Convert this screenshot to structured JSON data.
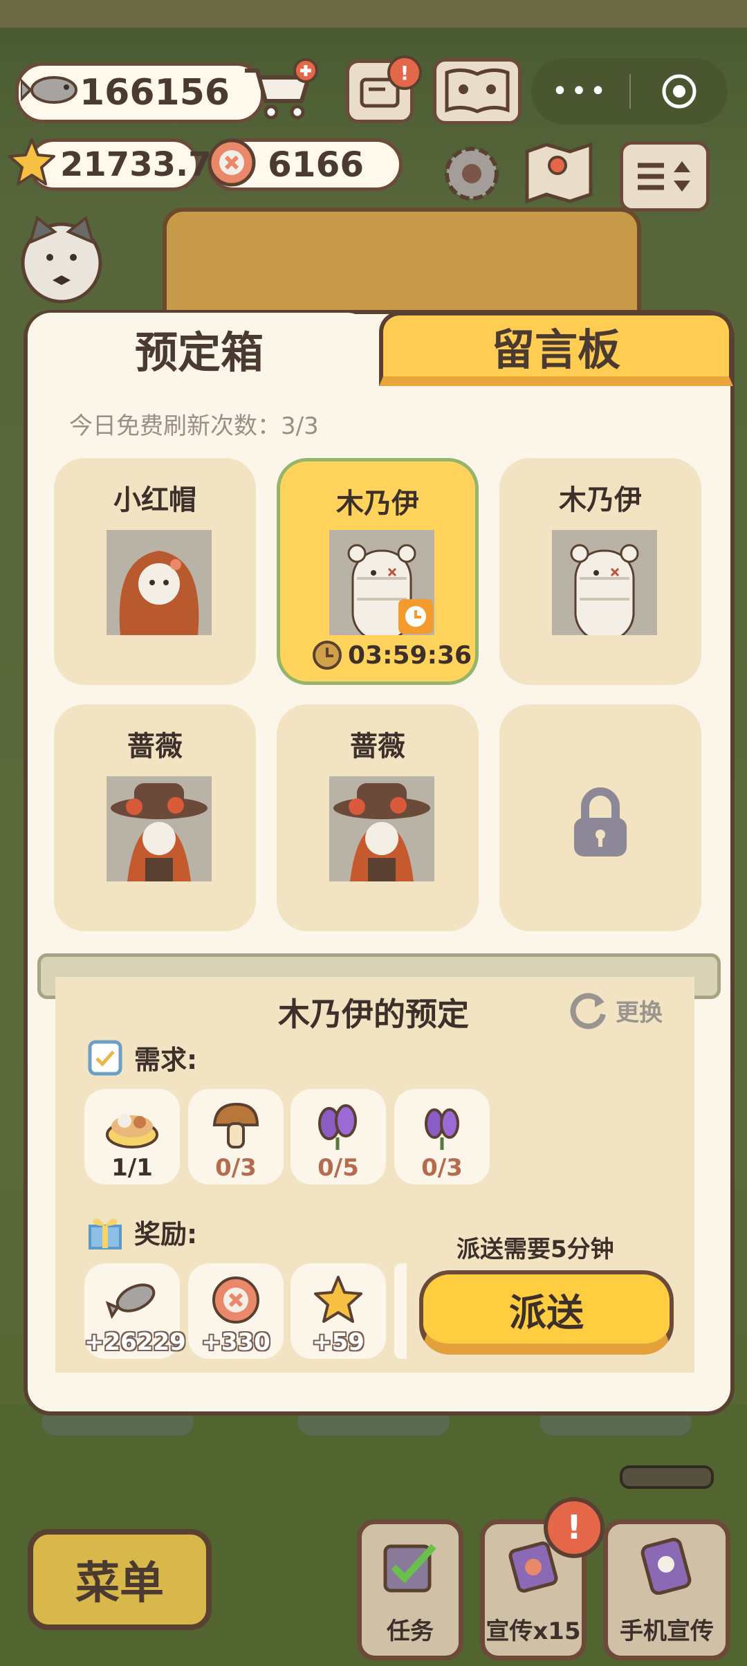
{
  "hud": {
    "fish": "166156",
    "stars": "21733.7",
    "coins": "6166"
  },
  "tabs": [
    {
      "label": "预定箱",
      "active": true
    },
    {
      "label": "留言板",
      "active": false
    }
  ],
  "refresh_text": "今日免费刷新次数：3/3",
  "cards": [
    {
      "name": "小红帽"
    },
    {
      "name": "木乃伊",
      "timer": "03:59:36"
    },
    {
      "name": "木乃伊"
    },
    {
      "name": "蔷薇"
    },
    {
      "name": "蔷薇"
    }
  ],
  "detail": {
    "title": "木乃伊的预定",
    "swap_label": "更换",
    "requirements_label": "需求:",
    "requirements": [
      {
        "icon": "dish-icon",
        "qty": "1/1"
      },
      {
        "icon": "mushroom-icon",
        "qty": "0/3"
      },
      {
        "icon": "purple-flower-icon",
        "qty": "0/5"
      },
      {
        "icon": "purple-flower-icon",
        "qty": "0/3"
      }
    ],
    "rewards_label": "奖励:",
    "rewards": [
      {
        "icon": "fish-icon",
        "qty": "+26229"
      },
      {
        "icon": "coin-icon",
        "qty": "+330"
      },
      {
        "icon": "star-icon",
        "qty": "+59"
      }
    ],
    "dispatch_note": "派送需要5分钟",
    "dispatch_button": "派送"
  },
  "bottom": {
    "menu": "菜单",
    "tasks": "任务",
    "promote": "宣传x15",
    "phone_promote": "手机宣传",
    "badge": "!"
  },
  "colors": {
    "accent_yellow": "#ffcd52",
    "panel_bg": "#fbf5ea",
    "card_bg": "#f2e3c2",
    "outline": "#5a4030"
  }
}
